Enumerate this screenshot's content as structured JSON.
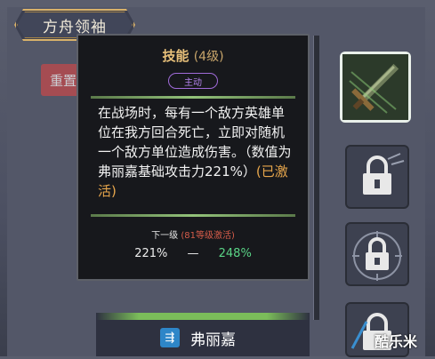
{
  "header": {
    "title": "方舟领袖"
  },
  "reset_button": {
    "label": "重置"
  },
  "tooltip": {
    "title": "技能",
    "level": "(4级)",
    "tag": "主动",
    "description": "在战场时，每有一个敌方英雄单位在我方回合死亡，立即对随机一个敌方单位造成伤害。（数值为弗丽嘉基础攻击力221%）",
    "activated": "(已激活)",
    "next_level_label": "下一级",
    "next_level_requirement": "(81等级激活)",
    "current_value": "221%",
    "separator": "—",
    "next_value": "248%"
  },
  "skills": [
    {
      "icon": "sword-icon",
      "state": "selected"
    },
    {
      "icon": "lock-icon",
      "state": "locked"
    },
    {
      "icon": "lock-icon",
      "state": "locked"
    },
    {
      "icon": "lock-icon",
      "state": "locked"
    }
  ],
  "hero": {
    "name": "弗丽嘉",
    "badge_icon": "class-icon"
  },
  "watermark": "酷乐米",
  "colors": {
    "accent_gold": "#d9b26a",
    "active_purple": "#a06bd9",
    "increase_green": "#5ad486",
    "activated_orange": "#e7a64c",
    "requirement_red": "#d65c4a"
  }
}
